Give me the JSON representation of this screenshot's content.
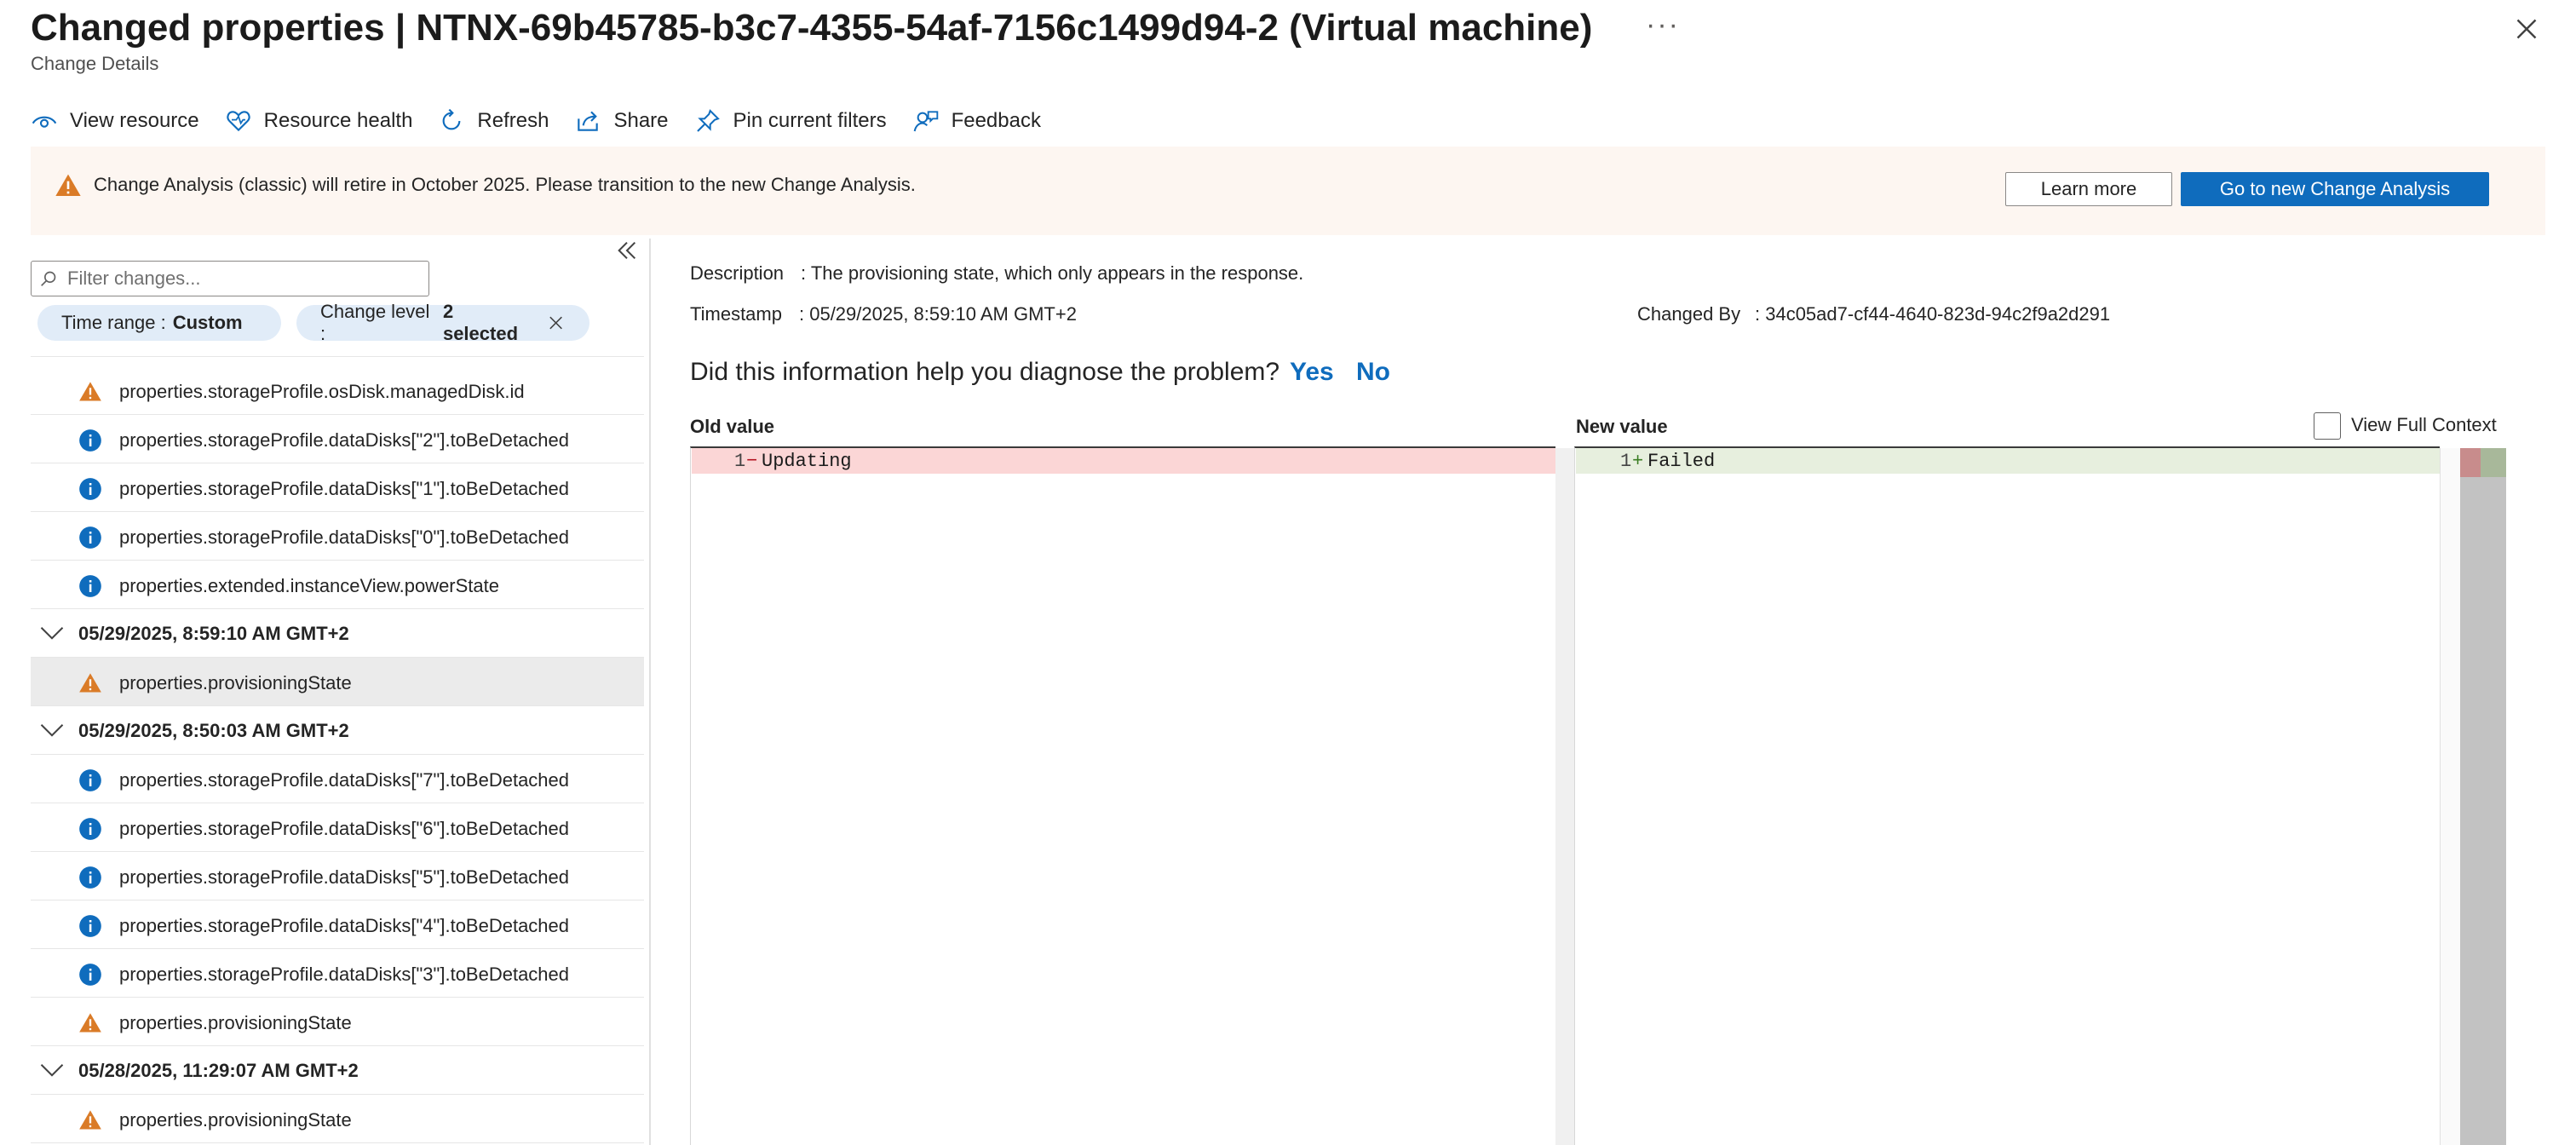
{
  "header": {
    "title": "Changed properties | NTNX-69b45785-b3c7-4355-54af-7156c1499d94-2 (Virtual machine)",
    "subtitle": "Change Details",
    "more": "···"
  },
  "toolbar": {
    "view_resource": "View resource",
    "resource_health": "Resource health",
    "refresh": "Refresh",
    "share": "Share",
    "pin_filters": "Pin current filters",
    "feedback": "Feedback"
  },
  "banner": {
    "text": "Change Analysis (classic) will retire in October 2025. Please transition to the new Change Analysis.",
    "learn_more": "Learn more",
    "go_new": "Go to new Change Analysis"
  },
  "filter": {
    "placeholder": "Filter changes...",
    "time_range_label": "Time range :",
    "time_range_value": "Custom",
    "change_level_label": "Change level :",
    "change_level_value": "2 selected"
  },
  "list": {
    "rows": [
      {
        "icon": "warning",
        "text": "properties.storageProfile.osDisk.managedDisk.id"
      },
      {
        "icon": "info",
        "text": "properties.storageProfile.dataDisks[\"2\"].toBeDetached"
      },
      {
        "icon": "info",
        "text": "properties.storageProfile.dataDisks[\"1\"].toBeDetached"
      },
      {
        "icon": "info",
        "text": "properties.storageProfile.dataDisks[\"0\"].toBeDetached"
      },
      {
        "icon": "info",
        "text": "properties.extended.instanceView.powerState"
      }
    ],
    "group1": {
      "date": "05/29/2025, 8:59:10 AM GMT+2"
    },
    "group1_rows": [
      {
        "icon": "warning",
        "text": "properties.provisioningState",
        "selected": true
      }
    ],
    "group2": {
      "date": "05/29/2025, 8:50:03 AM GMT+2"
    },
    "group2_rows": [
      {
        "icon": "info",
        "text": "properties.storageProfile.dataDisks[\"7\"].toBeDetached"
      },
      {
        "icon": "info",
        "text": "properties.storageProfile.dataDisks[\"6\"].toBeDetached"
      },
      {
        "icon": "info",
        "text": "properties.storageProfile.dataDisks[\"5\"].toBeDetached"
      },
      {
        "icon": "info",
        "text": "properties.storageProfile.dataDisks[\"4\"].toBeDetached"
      },
      {
        "icon": "info",
        "text": "properties.storageProfile.dataDisks[\"3\"].toBeDetached"
      },
      {
        "icon": "warning",
        "text": "properties.provisioningState"
      }
    ],
    "group3": {
      "date": "05/28/2025, 11:29:07 AM GMT+2"
    },
    "group3_rows": [
      {
        "icon": "warning",
        "text": "properties.provisioningState"
      }
    ]
  },
  "detail": {
    "description_label": "Description",
    "description_value": ": The provisioning state, which only appears in the response.",
    "timestamp_label": "Timestamp",
    "timestamp_value": ": 05/29/2025, 8:59:10 AM GMT+2",
    "changed_by_label": "Changed By",
    "changed_by_value": ": 34c05ad7-cf44-4640-823d-94c2f9a2d291",
    "question": "Did this information help you diagnose the problem?",
    "yes": "Yes",
    "no": "No",
    "old_header": "Old value",
    "new_header": "New value",
    "view_full_context": "View Full Context",
    "old_line_num": "1",
    "old_marker": "−",
    "old_code": "Updating",
    "new_line_num": "1",
    "new_marker": "+",
    "new_code": "Failed"
  },
  "colors": {
    "accent": "#0f6cbd",
    "warning": "#da7b27",
    "info": "#0f6cbd",
    "removed_bg": "#fbd6d6",
    "added_bg": "#e7efde",
    "banner_bg": "#fdf6f1",
    "pill_bg": "#e1ecf8"
  }
}
